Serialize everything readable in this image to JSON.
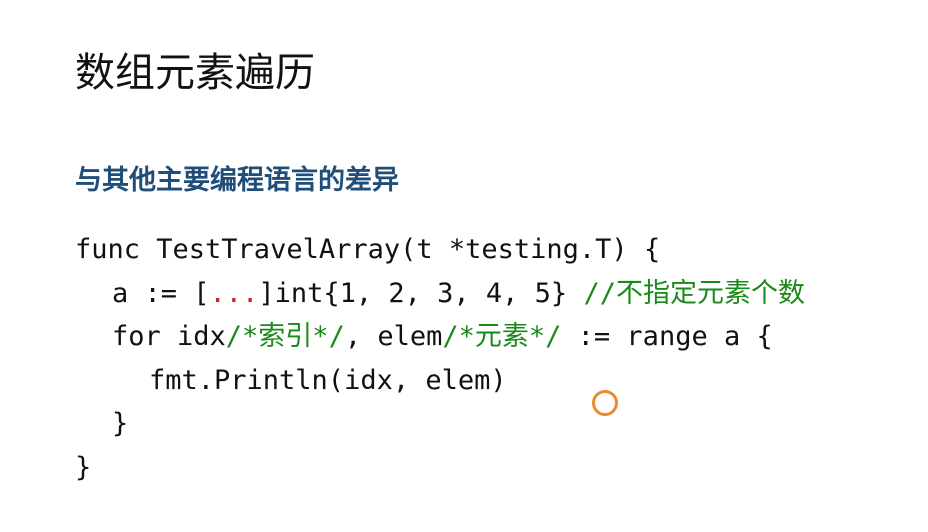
{
  "slide": {
    "title": "数组元素遍历",
    "subtitle": "与其他主要编程语言的差异"
  },
  "code": {
    "line1": "func TestTravelArray(t *testing.T) {",
    "line2_a": "a := [",
    "line2_ellipsis": "...",
    "line2_b": "]int{1, 2, 3, 4, 5} ",
    "line2_comment": "//不指定元素个数",
    "line3_a": "for idx",
    "line3_comment1": "/*索引*/",
    "line3_b": ", elem",
    "line3_comment2": "/*元素*/",
    "line3_c": " := range a {",
    "line4": "fmt.Println(idx, elem)",
    "line5": "}",
    "line6": "}"
  },
  "colors": {
    "title": "#111111",
    "subtitle": "#1f4e79",
    "ellipsis_highlight": "#cc2222",
    "comment": "#1a8a1a",
    "cursor_ring": "#ea8a2e"
  }
}
